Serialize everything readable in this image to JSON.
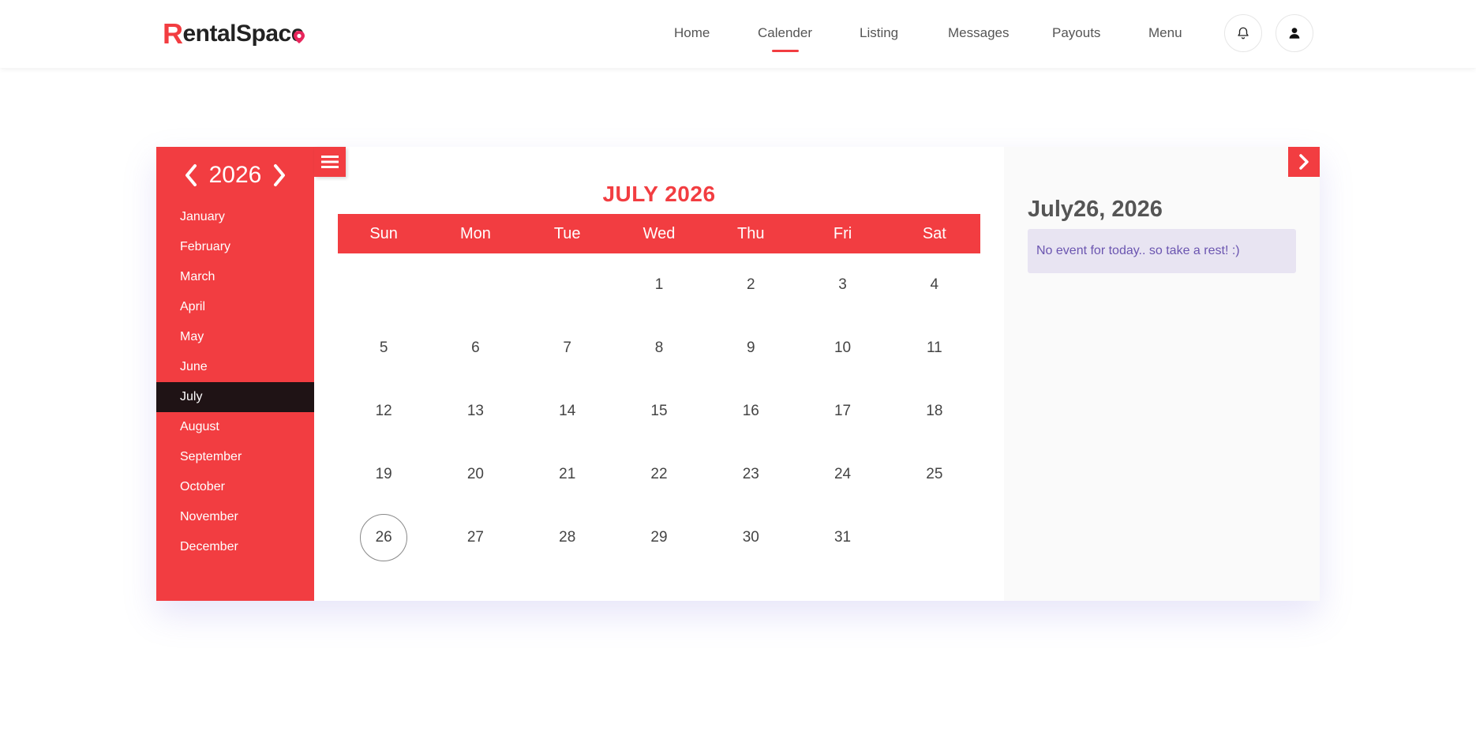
{
  "header": {
    "logo_r": "R",
    "logo_rest": "entalSpac",
    "logo_e": "e",
    "nav": [
      {
        "label": "Home"
      },
      {
        "label": "Calender"
      },
      {
        "label": "Listing"
      },
      {
        "label": "Messages"
      },
      {
        "label": "Payouts"
      },
      {
        "label": "Menu"
      }
    ],
    "active_nav": "Calender",
    "icons": [
      "bell-icon",
      "user-icon"
    ]
  },
  "calendar": {
    "year": "2026",
    "months": [
      "January",
      "February",
      "March",
      "April",
      "May",
      "June",
      "July",
      "August",
      "September",
      "October",
      "November",
      "December"
    ],
    "selected_month": "July",
    "title": "JULY 2026",
    "weekdays": [
      "Sun",
      "Mon",
      "Tue",
      "Wed",
      "Thu",
      "Fri",
      "Sat"
    ],
    "days": [
      "",
      "",
      "",
      "1",
      "2",
      "3",
      "4",
      "5",
      "6",
      "7",
      "8",
      "9",
      "10",
      "11",
      "12",
      "13",
      "14",
      "15",
      "16",
      "17",
      "18",
      "19",
      "20",
      "21",
      "22",
      "23",
      "24",
      "25",
      "26",
      "27",
      "28",
      "29",
      "30",
      "31",
      ""
    ],
    "today": "26"
  },
  "side": {
    "date": "July26, 2026",
    "note": "No event for today.. so take a rest! :)"
  },
  "colors": {
    "accent": "#f23d41",
    "active_month_bg": "#1f1315",
    "note_bg": "#e8e4f2",
    "note_text": "#6b55b0"
  }
}
